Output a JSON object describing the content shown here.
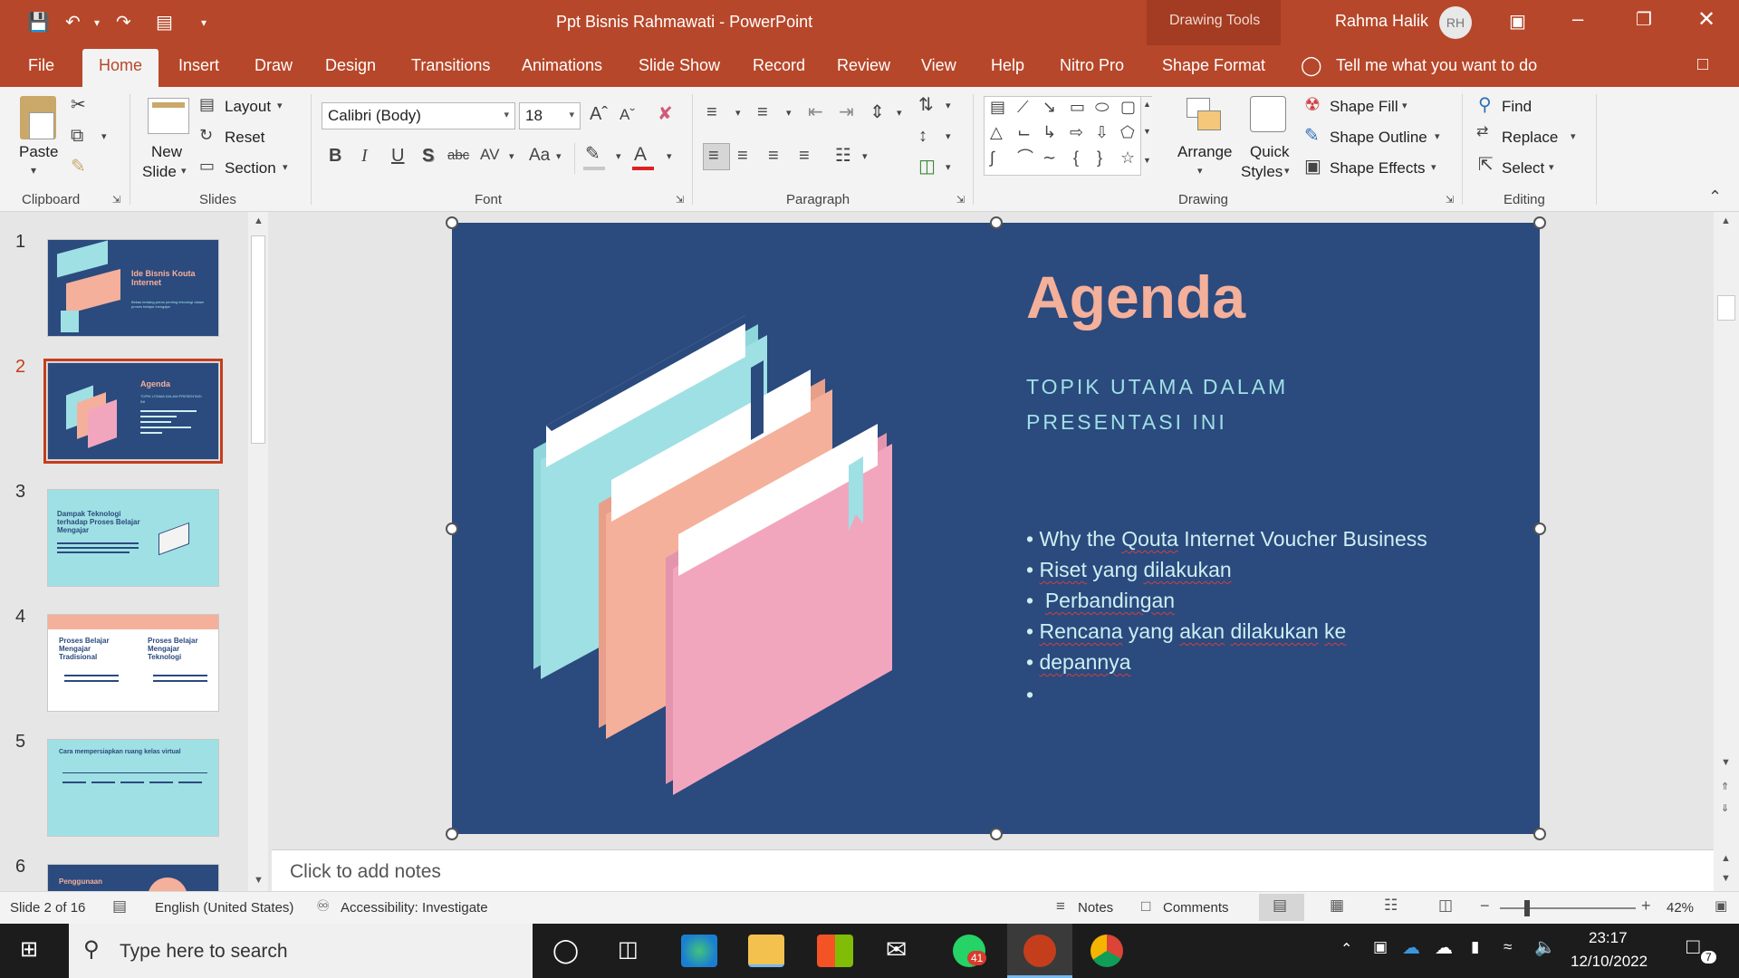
{
  "titlebar": {
    "doc_title": "Ppt Bisnis Rahmawati  -  PowerPoint",
    "context_tools": "Drawing Tools",
    "user_name": "Rahma Halik",
    "user_initials": "RH"
  },
  "tabs": [
    "File",
    "Home",
    "Insert",
    "Draw",
    "Design",
    "Transitions",
    "Animations",
    "Slide Show",
    "Record",
    "Review",
    "View",
    "Help",
    "Nitro Pro",
    "Shape Format"
  ],
  "tell_me": "Tell me what you want to do",
  "ribbon": {
    "clipboard": {
      "label": "Clipboard",
      "paste": "Paste"
    },
    "slides": {
      "label": "Slides",
      "new_slide_1": "New",
      "new_slide_2": "Slide",
      "layout": "Layout",
      "reset": "Reset",
      "section": "Section"
    },
    "font": {
      "label": "Font",
      "font_name": "Calibri (Body)",
      "font_size": "18",
      "bold": "B",
      "italic": "I",
      "underline": "U",
      "shadow": "S",
      "strike": "abc",
      "spacing": "AV",
      "case": "Aa",
      "color_a": "A"
    },
    "paragraph": {
      "label": "Paragraph"
    },
    "drawing": {
      "label": "Drawing",
      "arrange": "Arrange",
      "quick_1": "Quick",
      "quick_2": "Styles",
      "shape_fill": "Shape Fill",
      "shape_outline": "Shape Outline",
      "shape_effects": "Shape Effects"
    },
    "editing": {
      "label": "Editing",
      "find": "Find",
      "replace": "Replace",
      "select": "Select"
    }
  },
  "thumbnails": [
    {
      "num": "1",
      "title": "Ide Bisnis Kouta Internet",
      "subtitle": "Bekas tentang peran penting teknologi dalam proses belajar mengajar",
      "bg": "#2b4a7e"
    },
    {
      "num": "2",
      "title": "Agenda",
      "subtitle": "TOPIK UTAMA DALAM PRESENTASI INI",
      "bg": "#2b4a7e"
    },
    {
      "num": "3",
      "title": "Dampak Teknologi terhadap Proses Belajar Mengajar",
      "bg": "#9fe0e4"
    },
    {
      "num": "4",
      "title_left": "Proses Belajar Mengajar Tradisional",
      "title_right": "Proses Belajar Mengajar Teknologi",
      "bg": "#ffffff"
    },
    {
      "num": "5",
      "title": "Cara mempersiapkan ruang kelas virtual",
      "bg": "#9fe0e4"
    },
    {
      "num": "6",
      "title": "Penggunaan",
      "bg": "#2b4a7e"
    }
  ],
  "slide": {
    "title": "Agenda",
    "subtitle_1": "TOPIK UTAMA DALAM",
    "subtitle_2": "PRESENTASI INI",
    "bullets": [
      {
        "pre": "Why the ",
        "sq": "Qouta",
        "post": " Internet Voucher Business"
      },
      {
        "pre": "",
        "sq": "Riset",
        "post": " yang ",
        "sq2": "dilakukan"
      },
      {
        "pre": " ",
        "sq": "Perbandingan",
        "post": ""
      },
      {
        "pre": "",
        "sq": "Rencana",
        "post": " yang ",
        "sq2": "akan",
        "post2": " ",
        "sq3": "dilakukan",
        "post3": " ",
        "sq4": "ke"
      },
      {
        "pre": "",
        "sq": "depannya",
        "post": ""
      }
    ],
    "colors": {
      "bg": "#2b4a7e",
      "title": "#f4b09a",
      "subtitle": "#9fe0e4",
      "folder_teal": "#9fe0e4",
      "folder_peach": "#f4b09a",
      "folder_pink": "#f2a6be"
    }
  },
  "notes_placeholder": "Click to add notes",
  "status": {
    "slide_info": "Slide 2 of 16",
    "language": "English (United States)",
    "accessibility": "Accessibility: Investigate",
    "notes": "Notes",
    "comments": "Comments",
    "zoom": "42%"
  },
  "taskbar": {
    "search_placeholder": "Type here to search",
    "whatsapp_badge": "41",
    "time": "23:17",
    "date": "12/10/2022",
    "notif_count": "7"
  }
}
